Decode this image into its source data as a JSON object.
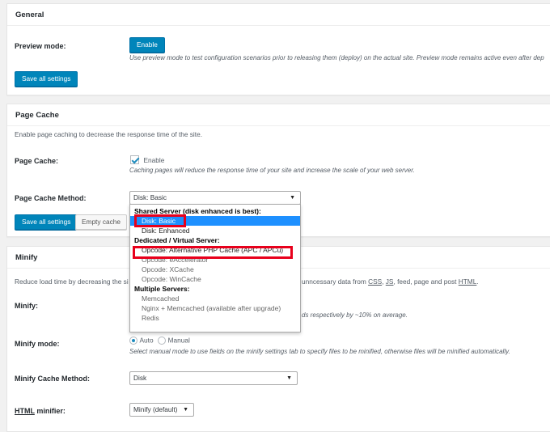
{
  "general": {
    "title": "General",
    "preview_label": "Preview mode:",
    "enable_button": "Enable",
    "preview_desc": "Use preview mode to test configuration scenarios prior to releasing them (deploy) on the actual site. Preview mode remains active even after dep",
    "save_button": "Save all settings"
  },
  "page_cache": {
    "title": "Page Cache",
    "intro": "Enable page caching to decrease the response time of the site.",
    "label": "Page Cache:",
    "checkbox_label": "Enable",
    "checkbox_checked": true,
    "desc": "Caching pages will reduce the response time of your site and increase the scale of your web server.",
    "method_label": "Page Cache Method:",
    "method_value": "Disk: Basic",
    "save_button": "Save all settings",
    "empty_button": "Empty cache"
  },
  "dropdown": {
    "groups": [
      {
        "label": "Shared Server (disk enhanced is best):",
        "options": [
          {
            "label": "Disk: Basic",
            "selected": true,
            "enabled": true
          },
          {
            "label": "Disk: Enhanced",
            "selected": false,
            "enabled": true
          }
        ]
      },
      {
        "label": "Dedicated / Virtual Server:",
        "options": [
          {
            "label": "Opcode: Alternative PHP Cache (APC / APCu)",
            "selected": false,
            "enabled": true
          },
          {
            "label": "Opcode: eAccelerator",
            "selected": false,
            "enabled": false
          },
          {
            "label": "Opcode: XCache",
            "selected": false,
            "enabled": false
          },
          {
            "label": "Opcode: WinCache",
            "selected": false,
            "enabled": false
          }
        ]
      },
      {
        "label": "Multiple Servers:",
        "options": [
          {
            "label": "Memcached",
            "selected": false,
            "enabled": false
          },
          {
            "label": "Nginx + Memcached (available after upgrade)",
            "selected": false,
            "enabled": false
          },
          {
            "label": "Redis",
            "selected": false,
            "enabled": false
          }
        ]
      }
    ],
    "highlight_color": "#e8001c",
    "selected_color": "#1e90ff"
  },
  "minify": {
    "title": "Minify",
    "intro_left": "Reduce load time by decreasing the si",
    "intro_right_prefix": "unncessary data from ",
    "intro_css": "CSS",
    "intro_sep1": ", ",
    "intro_js": "JS",
    "intro_sep2": ", feed, page and post ",
    "intro_html": "HTML",
    "intro_end": ".",
    "label": "Minify:",
    "desc_partial": "ds respectively by ~10% on average.",
    "mode_label": "Minify mode:",
    "mode_auto": "Auto",
    "mode_manual": "Manual",
    "mode_selected": "Auto",
    "mode_desc": "Select manual mode to use fields on the minify settings tab to specify files to be minified, otherwise files will be minified automatically.",
    "cache_method_label": "Minify Cache Method:",
    "cache_method_value": "Disk",
    "html_label_abbr": "HTML",
    "html_label_rest": " minifier:",
    "html_value": "Minify (default)"
  },
  "colors": {
    "primary": "#0085ba",
    "checkmark": "#1e8cbe"
  }
}
